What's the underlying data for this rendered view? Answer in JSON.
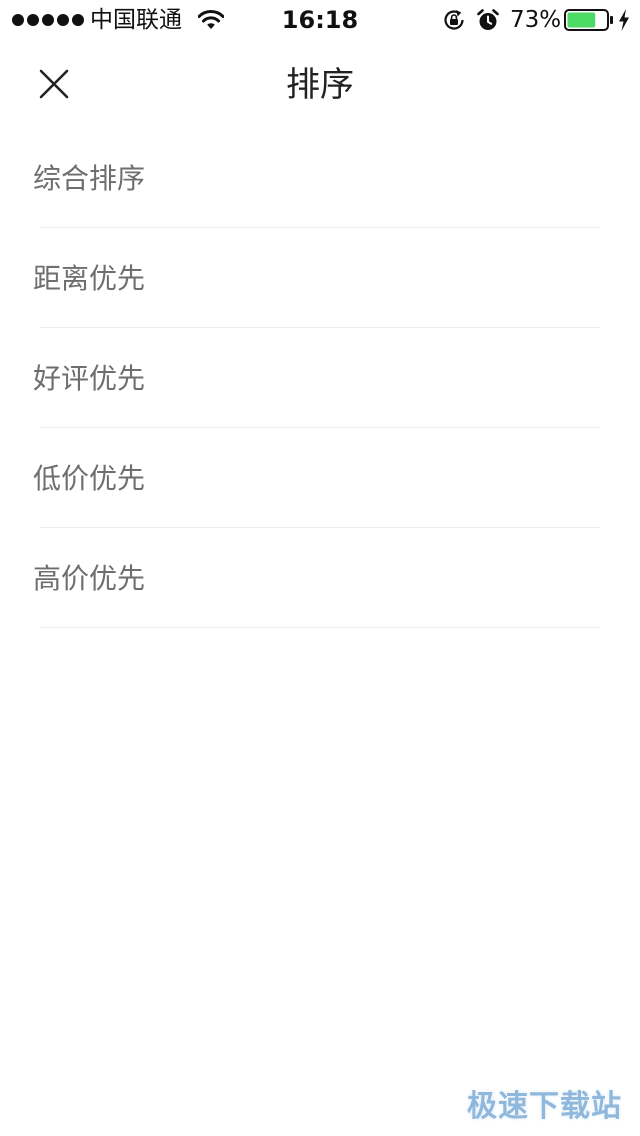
{
  "status_bar": {
    "carrier": "中国联通",
    "time": "16:18",
    "battery_percent": "73%",
    "battery_level": 0.73,
    "signal_bars": 5
  },
  "nav": {
    "title": "排序"
  },
  "sort_options": [
    {
      "label": "综合排序"
    },
    {
      "label": "距离优先"
    },
    {
      "label": "好评优先"
    },
    {
      "label": "低价优先"
    },
    {
      "label": "高价优先"
    }
  ],
  "watermark": {
    "text": "极速下载站"
  },
  "colors": {
    "battery_fill": "#4cd964",
    "option_text": "#6e6e6e",
    "divider": "#ececec",
    "watermark": "#8fb8dc"
  },
  "icons": {
    "close": "close-icon",
    "wifi": "wifi-icon",
    "rotation_lock": "rotation-lock-icon",
    "alarm": "alarm-icon",
    "battery": "battery-icon",
    "charging": "charging-icon"
  }
}
